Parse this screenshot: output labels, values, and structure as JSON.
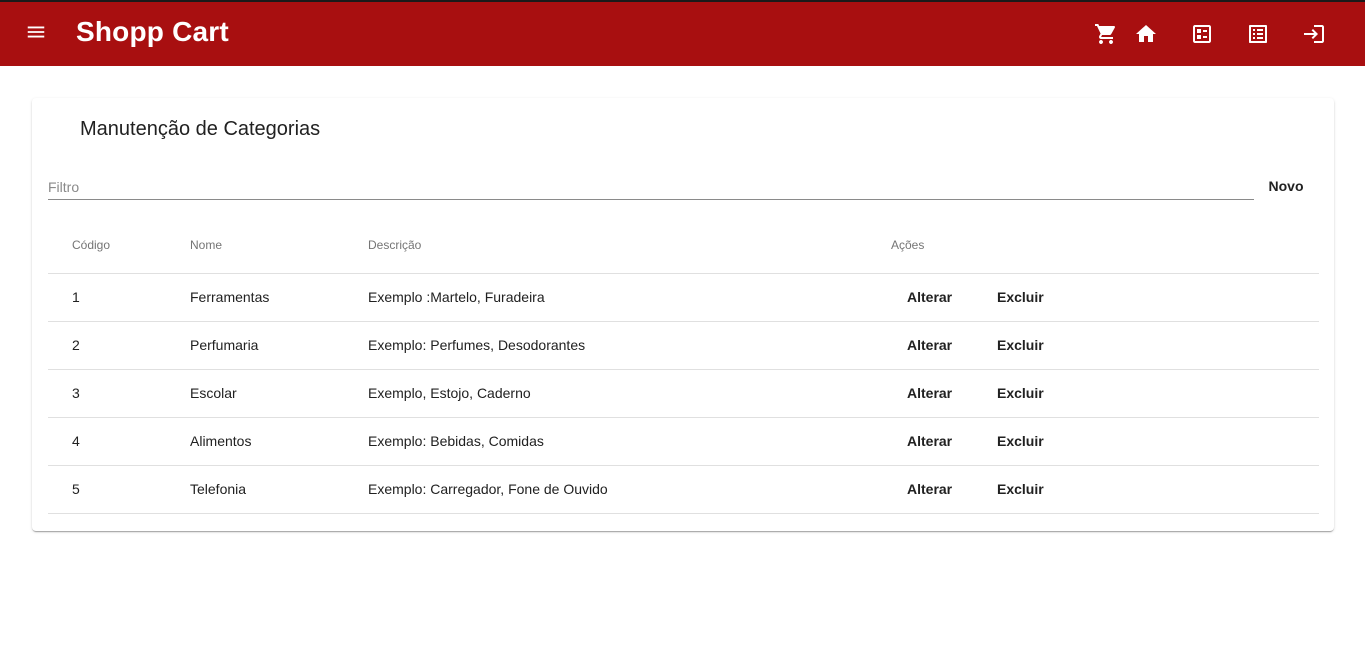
{
  "colors": {
    "toolbar_bg": "#a80f10",
    "toolbar_fg": "#ffffff"
  },
  "toolbar": {
    "title": "Shopp Cart",
    "icons": [
      "menu-icon",
      "cart-icon",
      "home-icon",
      "list-alt-icon",
      "list-icon",
      "login-icon"
    ]
  },
  "card": {
    "title": "Manutenção de Categorias",
    "filter": {
      "placeholder": "Filtro",
      "value": ""
    },
    "new_button": "Novo"
  },
  "table": {
    "headers": {
      "codigo": "Código",
      "nome": "Nome",
      "descricao": "Descrição",
      "acoes": "Ações"
    },
    "rows": [
      {
        "codigo": "1",
        "nome": "Ferramentas",
        "descricao": "Exemplo :Martelo, Furadeira",
        "alterar": "Alterar",
        "excluir": "Excluir"
      },
      {
        "codigo": "2",
        "nome": "Perfumaria",
        "descricao": "Exemplo: Perfumes, Desodorantes",
        "alterar": "Alterar",
        "excluir": "Excluir"
      },
      {
        "codigo": "3",
        "nome": "Escolar",
        "descricao": "Exemplo, Estojo, Caderno",
        "alterar": "Alterar",
        "excluir": "Excluir"
      },
      {
        "codigo": "4",
        "nome": "Alimentos",
        "descricao": "Exemplo: Bebidas, Comidas",
        "alterar": "Alterar",
        "excluir": "Excluir"
      },
      {
        "codigo": "5",
        "nome": "Telefonia",
        "descricao": "Exemplo: Carregador, Fone de Ouvido",
        "alterar": "Alterar",
        "excluir": "Excluir"
      }
    ]
  }
}
